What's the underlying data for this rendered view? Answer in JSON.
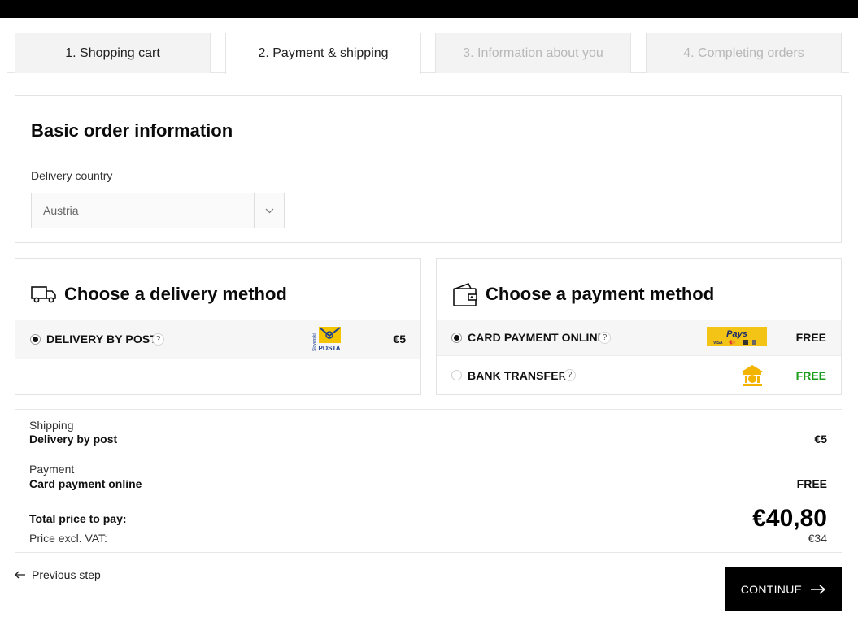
{
  "tabs": [
    {
      "label": "1. Shopping cart",
      "state": "default"
    },
    {
      "label": "2. Payment & shipping",
      "state": "active"
    },
    {
      "label": "3. Information about you",
      "state": "disabled"
    },
    {
      "label": "4. Completing orders",
      "state": "disabled"
    }
  ],
  "basic": {
    "title": "Basic order information",
    "country_label": "Delivery country",
    "country_value": "Austria"
  },
  "delivery": {
    "title": "Choose a delivery method",
    "icon": "truck-icon",
    "options": [
      {
        "label": "DELIVERY BY POST",
        "help": "?",
        "price": "€5",
        "selected": true,
        "logo": "slovenska-posta-logo",
        "logo_text": "POSTA",
        "logo_side_text": "Slovenská"
      }
    ]
  },
  "payment": {
    "title": "Choose a payment method",
    "icon": "wallet-icon",
    "options": [
      {
        "label": "CARD PAYMENT ONLINE",
        "help": "?",
        "price": "FREE",
        "selected": true,
        "logo": "pays-logo",
        "logo_text": "Pays",
        "logo_subtext": "VISA"
      },
      {
        "label": "BANK TRANSFER",
        "help": "?",
        "price": "FREE",
        "selected": false,
        "logo": "bank-icon"
      }
    ]
  },
  "summary": {
    "shipping_label": "Shipping",
    "shipping_value": "Delivery by post",
    "shipping_price": "€5",
    "payment_label": "Payment",
    "payment_value": "Card payment online",
    "payment_price": "FREE",
    "total_label": "Total price to pay:",
    "total_price": "€40,80",
    "excl_vat_label": "Price excl. VAT:",
    "excl_vat_price": "€34"
  },
  "nav": {
    "previous_label": "Previous step",
    "continue_label": "CONTINUE"
  },
  "colors": {
    "accent": "#000000",
    "free_green": "#1b9e1b",
    "posta_yellow": "#f5c400",
    "pays_yellow": "#f3c316"
  }
}
